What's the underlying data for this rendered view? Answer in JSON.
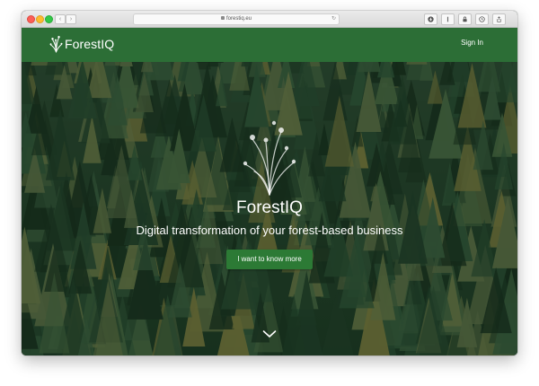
{
  "browser": {
    "url": "forestiq.eu",
    "back_glyph": "‹",
    "forward_glyph": "›",
    "reload_glyph": "↻",
    "toolbar_icons": [
      "download-icon",
      "extension-icon",
      "password-icon",
      "history-icon",
      "share-icon"
    ]
  },
  "header": {
    "logo_text": "ForestIQ",
    "signin_label": "Sign In",
    "background_color": "#2c6e36"
  },
  "hero": {
    "title": "ForestIQ",
    "subtitle": "Digital transformation of your forest-based business",
    "cta_label": "I want to know more",
    "cta_color": "#2c7a35",
    "scroll_icon": "chevron-down-icon"
  }
}
